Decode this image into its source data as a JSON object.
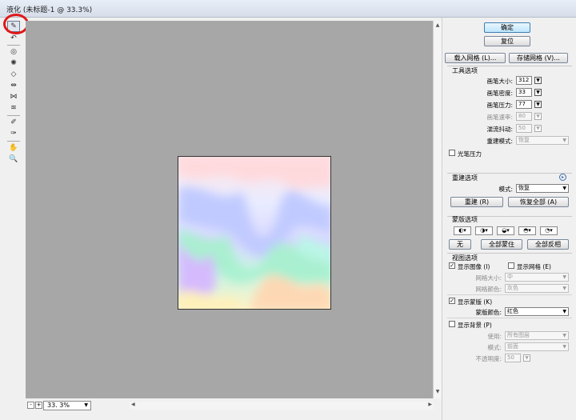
{
  "window": {
    "title": "液化 (未标题-1 @ 33.3%)"
  },
  "tools": [
    {
      "icon": "forward-warp-icon",
      "glyph": "✎",
      "active": true
    },
    {
      "icon": "reconstruct-icon",
      "glyph": "↶",
      "active": false
    },
    {
      "icon": "twirl-icon",
      "glyph": "◎",
      "active": false
    },
    {
      "icon": "pucker-icon",
      "glyph": "✺",
      "active": false
    },
    {
      "icon": "bloat-icon",
      "glyph": "◇",
      "active": false
    },
    {
      "icon": "push-left-icon",
      "glyph": "⇹",
      "active": false
    },
    {
      "icon": "mirror-icon",
      "glyph": "⋈",
      "active": false
    },
    {
      "icon": "turbulence-icon",
      "glyph": "≋",
      "active": false
    },
    {
      "icon": "freeze-mask-icon",
      "glyph": "✐",
      "active": false
    },
    {
      "icon": "thaw-mask-icon",
      "glyph": "✑",
      "active": false
    },
    {
      "icon": "hand-icon",
      "glyph": "✋",
      "active": false
    },
    {
      "icon": "zoom-icon",
      "glyph": "🔍",
      "active": false
    }
  ],
  "status": {
    "zoom": "33. 3%",
    "minus": "-",
    "plus": "+"
  },
  "actions": {
    "ok": "确定",
    "reset": "复位",
    "load_mesh": "载入网格 (L)...",
    "save_mesh": "存储网格 (V)..."
  },
  "tool_options": {
    "title": "工具选项",
    "brush_size_label": "画笔大小:",
    "brush_size": "312",
    "brush_density_label": "画笔密度:",
    "brush_density": "33",
    "brush_pressure_label": "画笔压力:",
    "brush_pressure": "77",
    "brush_rate_label": "画笔速率:",
    "brush_rate": "80",
    "turbulent_jitter_label": "湍流抖动:",
    "turbulent_jitter": "50",
    "reconstruct_mode_label": "重建模式:",
    "reconstruct_mode": "恢复",
    "stylus_pressure_label": "光笔压力"
  },
  "reconstruct_options": {
    "title": "重建选项",
    "mode_label": "模式:",
    "mode": "恢复",
    "reconstruct_btn": "重建 (R)",
    "restore_all_btn": "恢复全部 (A)"
  },
  "mask_options": {
    "title": "蒙版选项",
    "none_btn": "无",
    "mask_all_btn": "全部蒙住",
    "invert_all_btn": "全部反相"
  },
  "view_options": {
    "title": "视图选项",
    "show_image_label": "显示图像 (I)",
    "show_mesh_label": "显示网格 (E)",
    "mesh_size_label": "网格大小:",
    "mesh_size": "中",
    "mesh_color_label": "网格颜色:",
    "mesh_color": "灰色",
    "show_mask_label": "显示蒙版 (K)",
    "mask_color_label": "蒙版颜色:",
    "mask_color": "红色",
    "show_backdrop_label": "显示背景 (P)",
    "use_label": "使用:",
    "use": "所有图层",
    "mode_label": "模式:",
    "mode": "前面",
    "opacity_label": "不透明度:",
    "opacity": "50"
  }
}
